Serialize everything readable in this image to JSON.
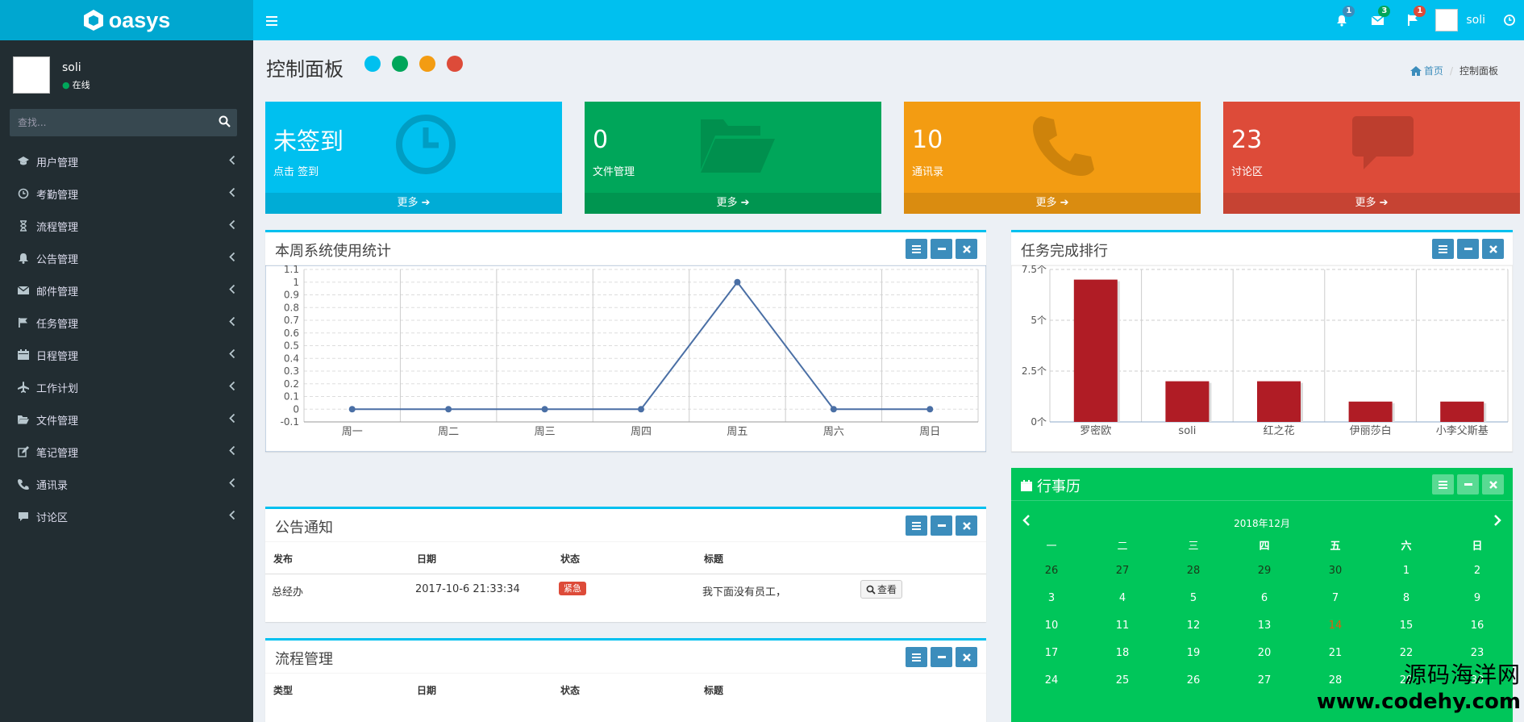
{
  "app": {
    "name": "oasys"
  },
  "header": {
    "badges": {
      "bell": "1",
      "mail": "3",
      "flag": "1"
    },
    "username": "soli"
  },
  "user_panel": {
    "name": "soli",
    "status": "在线"
  },
  "search": {
    "placeholder": "查找..."
  },
  "menu": [
    {
      "label": "用户管理",
      "icon": "graduation-cap-icon"
    },
    {
      "label": "考勤管理",
      "icon": "clock-icon"
    },
    {
      "label": "流程管理",
      "icon": "hourglass-icon"
    },
    {
      "label": "公告管理",
      "icon": "bell-icon"
    },
    {
      "label": "邮件管理",
      "icon": "envelope-icon"
    },
    {
      "label": "任务管理",
      "icon": "flag-icon"
    },
    {
      "label": "日程管理",
      "icon": "calendar-icon"
    },
    {
      "label": "工作计划",
      "icon": "plane-icon"
    },
    {
      "label": "文件管理",
      "icon": "folder-open-icon"
    },
    {
      "label": "笔记管理",
      "icon": "edit-icon"
    },
    {
      "label": "通讯录",
      "icon": "phone-icon"
    },
    {
      "label": "讨论区",
      "icon": "comment-icon"
    }
  ],
  "page": {
    "title": "控制面板"
  },
  "breadcrumb": {
    "home": "首页",
    "current": "控制面板"
  },
  "colors": {
    "aqua": "#00c0ef",
    "green": "#00a65a",
    "yellow": "#f39c12",
    "red": "#dd4b39",
    "sidebar": "#222d32",
    "bar": "#b01c25",
    "line": "#4a6fa5"
  },
  "stats": [
    {
      "value": "未签到",
      "label": "点击 签到",
      "footer": "更多",
      "icon": "clock-icon"
    },
    {
      "value": "0",
      "label": "文件管理",
      "footer": "更多",
      "icon": "folder-open-icon"
    },
    {
      "value": "10",
      "label": "通讯录",
      "footer": "更多",
      "icon": "phone-icon"
    },
    {
      "value": "23",
      "label": "讨论区",
      "footer": "更多",
      "icon": "comment-icon"
    }
  ],
  "usage_box": {
    "title": "本周系统使用统计"
  },
  "rank_box": {
    "title": "任务完成排行"
  },
  "chart_data": [
    {
      "type": "line",
      "categories": [
        "周一",
        "周二",
        "周三",
        "周四",
        "周五",
        "周六",
        "周日"
      ],
      "values": [
        0,
        0,
        0,
        0,
        1,
        0,
        0
      ],
      "ylim": [
        -0.1,
        1.1
      ],
      "yticks": [
        "1.1",
        "1",
        "0.9",
        "0.8",
        "0.7",
        "0.6",
        "0.5",
        "0.4",
        "0.3",
        "0.2",
        "0.1",
        "0",
        "-0.1"
      ],
      "grid": true
    },
    {
      "type": "bar",
      "categories": [
        "罗密欧",
        "soli",
        "红之花",
        "伊丽莎白",
        "小李父斯基"
      ],
      "values": [
        7,
        2,
        2,
        1,
        1
      ],
      "ylim": [
        0,
        7.5
      ],
      "yticks": [
        "7.5个",
        "5个",
        "2.5个",
        "0个"
      ],
      "grid": true
    }
  ],
  "notice_box": {
    "title": "公告通知",
    "headers": [
      "发布",
      "日期",
      "状态",
      "标题"
    ],
    "rows": [
      {
        "publisher": "总经办",
        "date": "2017-10-6 21:33:34",
        "status": "紧急",
        "title": "我下面没有员工，",
        "action": "查看"
      }
    ]
  },
  "process_box": {
    "title": "流程管理",
    "headers": [
      "类型",
      "日期",
      "状态",
      "标题"
    ]
  },
  "calendar": {
    "title": "行事历",
    "month": "2018年12月",
    "weekdays": [
      "一",
      "二",
      "三",
      "四",
      "五",
      "六",
      "日"
    ],
    "weeks": [
      [
        "26",
        "27",
        "28",
        "29",
        "30",
        "1",
        "2"
      ],
      [
        "3",
        "4",
        "5",
        "6",
        "7",
        "8",
        "9"
      ],
      [
        "10",
        "11",
        "12",
        "13",
        "14",
        "15",
        "16"
      ],
      [
        "17",
        "18",
        "19",
        "20",
        "21",
        "22",
        "23"
      ],
      [
        "24",
        "25",
        "26",
        "27",
        "28",
        "29",
        "30"
      ]
    ],
    "today": "14"
  },
  "watermark": {
    "cn": "源码海洋网",
    "url": "www.codehy.com"
  }
}
